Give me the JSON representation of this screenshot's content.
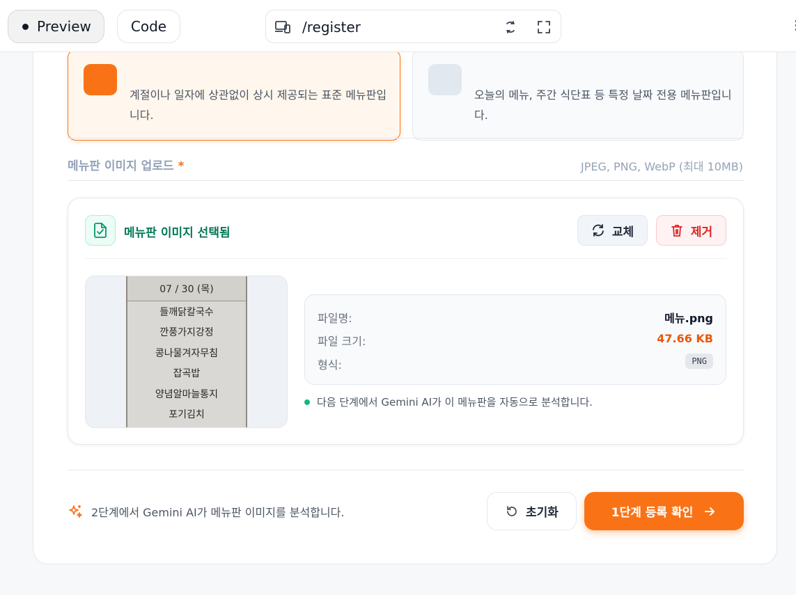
{
  "topbar": {
    "preview_label": "Preview",
    "code_label": "Code",
    "url_path": "/register"
  },
  "menu_types": {
    "standard_desc": "계절이나 일자에 상관없이 상시 제공되는 표준 메뉴판입니다.",
    "dated_desc": "오늘의 메뉴, 주간 식단표 등 특정 날짜 전용 메뉴판입니다."
  },
  "upload": {
    "label": "메뉴판 이미지 업로드",
    "required_mark": "*",
    "hint": "JPEG, PNG, WebP (최대 10MB)",
    "selected_title": "메뉴판 이미지 선택됨",
    "replace_label": "교체",
    "remove_label": "제거",
    "preview_image": {
      "date": "07 / 30 (목)",
      "lines": [
        "들깨닭칼국수",
        "깐풍가지강정",
        "콩나물겨자무침",
        "잡곡밥",
        "양념알마늘통지",
        "포기김치"
      ]
    },
    "file_info": {
      "name_key": "파일명:",
      "name_value": "메뉴.png",
      "size_key": "파일 크기:",
      "size_value": "47.66 KB",
      "format_key": "형식:",
      "format_value": "PNG"
    },
    "analyze_note": "다음 단계에서 Gemini AI가 이 메뉴판을 자동으로 분석합니다."
  },
  "footer": {
    "note": "2단계에서 Gemini AI가 메뉴판 이미지를 분석합니다.",
    "reset_label": "초기화",
    "confirm_label": "1단계 등록 확인"
  },
  "colors": {
    "accent": "#f97316",
    "success": "#047857",
    "danger": "#dc2626"
  }
}
